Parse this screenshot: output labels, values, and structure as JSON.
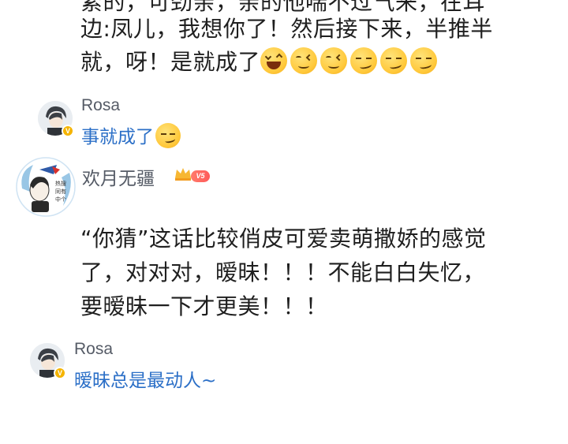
{
  "top_comment": {
    "lines": [
      "紧的，可劲亲，亲的他喘不过气来，在耳",
      "边:凤儿，我想你了！然后接下来，半推半",
      "就，呀！是就成了"
    ],
    "emojis": [
      "laugh-emoji",
      "wink-emoji",
      "wink-emoji",
      "smirk-emoji",
      "smirk-emoji",
      "smirk-emoji"
    ]
  },
  "reply1": {
    "username": "Rosa",
    "badge": "V",
    "text": "事就成了",
    "emoji": "smirk-emoji"
  },
  "main_comment": {
    "username": "欢月无疆",
    "vip_badge": "V5",
    "lines": [
      "“你猜”这话比较俏皮可爱卖萌撒娇的感觉",
      "了，对对对，暧昧！！！不能白白失忆，",
      "要暧昧一下才更美！！！"
    ]
  },
  "reply2": {
    "username": "Rosa",
    "badge": "V",
    "text": "暧昧总是最动人~"
  },
  "colors": {
    "link_blue": "#2b6fc7",
    "username_gray": "#555b66",
    "verified_gold": "#f5b400",
    "vip_red": "#ff5a5a"
  }
}
